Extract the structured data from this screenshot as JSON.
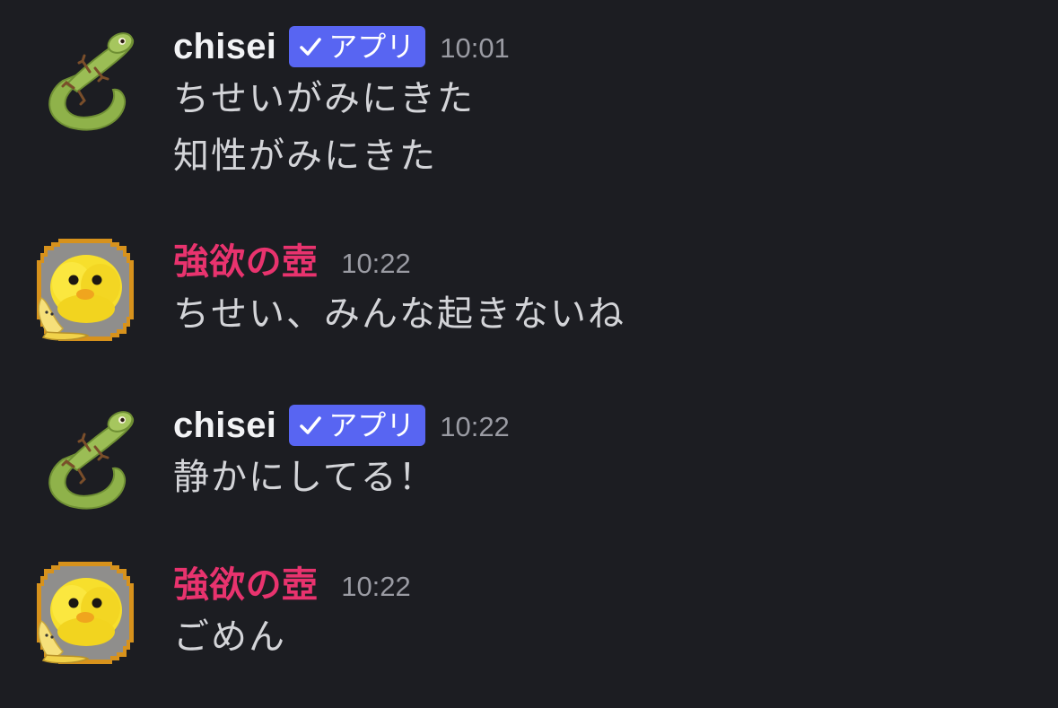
{
  "messages": [
    {
      "username": "chisei",
      "is_app": true,
      "badge_label": "アプリ",
      "time": "10:01",
      "lines": [
        "ちせいがみにきた",
        "知性がみにきた"
      ],
      "avatar_icon": "lizard-avatar-icon"
    },
    {
      "username": "強欲の壺",
      "is_app": false,
      "time": "10:22",
      "lines": [
        "ちせい、みんな起きないね"
      ],
      "avatar_icon": "chick-avatar-icon"
    },
    {
      "username": "chisei",
      "is_app": true,
      "badge_label": "アプリ",
      "time": "10:22",
      "lines": [
        "静かにしてる！"
      ],
      "avatar_icon": "lizard-avatar-icon"
    },
    {
      "username": "強欲の壺",
      "is_app": false,
      "time": "10:22",
      "lines": [
        "ごめん"
      ],
      "avatar_icon": "chick-avatar-icon"
    }
  ],
  "colors": {
    "background": "#1c1d22",
    "app_badge": "#5865f2",
    "pink_username": "#e8336e",
    "white_username": "#f2f3f5",
    "timestamp": "#9a9ba3",
    "message_text": "#d3d4d8"
  }
}
